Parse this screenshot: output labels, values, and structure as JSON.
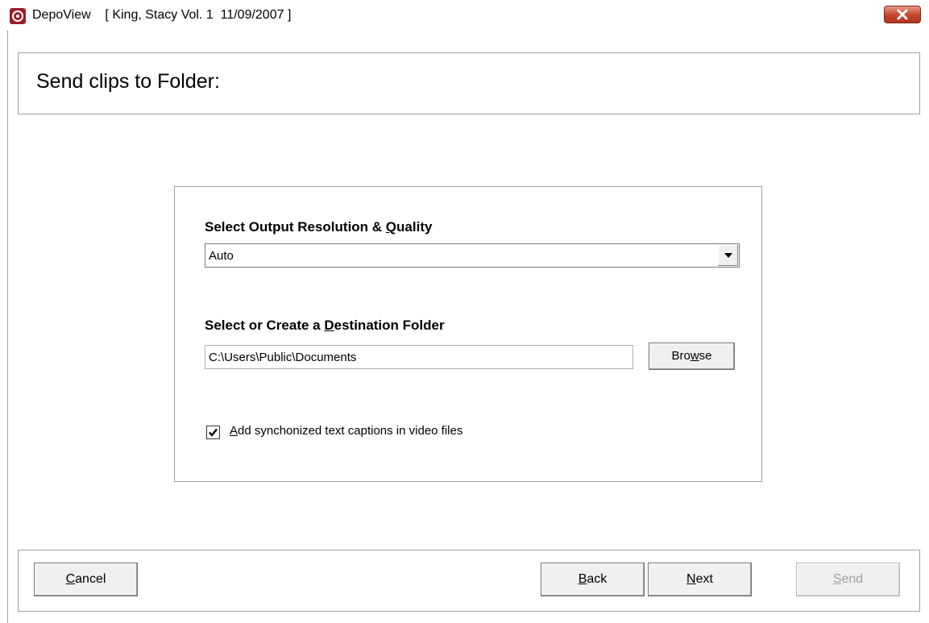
{
  "window": {
    "app_name": "DepoView",
    "title_detail": "[ King, Stacy Vol. 1  11/09/2007 ]",
    "app_icon": "depoview-logo-icon",
    "close_icon": "close-icon",
    "close_color": "#c2452d"
  },
  "header": {
    "title": "Send clips to Folder:"
  },
  "options": {
    "quality": {
      "label_pre": "Select Output Resolution & ",
      "label_mnemonic": "Q",
      "label_post": "uality",
      "selected": "Auto"
    },
    "destination": {
      "label_pre": "Select or Create a ",
      "label_mnemonic": "D",
      "label_post": "estination Folder",
      "value": "C:\\Users\\Public\\Documents",
      "browse_pre": "Bro",
      "browse_mnemonic": "w",
      "browse_post": "se"
    },
    "captions": {
      "checked": true,
      "label_mnemonic": "A",
      "label_post": "dd synchonized text captions in video files"
    }
  },
  "footer": {
    "cancel": {
      "mnemonic": "C",
      "rest": "ancel"
    },
    "back": {
      "mnemonic": "B",
      "rest": "ack"
    },
    "next": {
      "mnemonic": "N",
      "rest": "ext"
    },
    "send": {
      "mnemonic": "S",
      "rest": "end",
      "enabled": false
    }
  }
}
